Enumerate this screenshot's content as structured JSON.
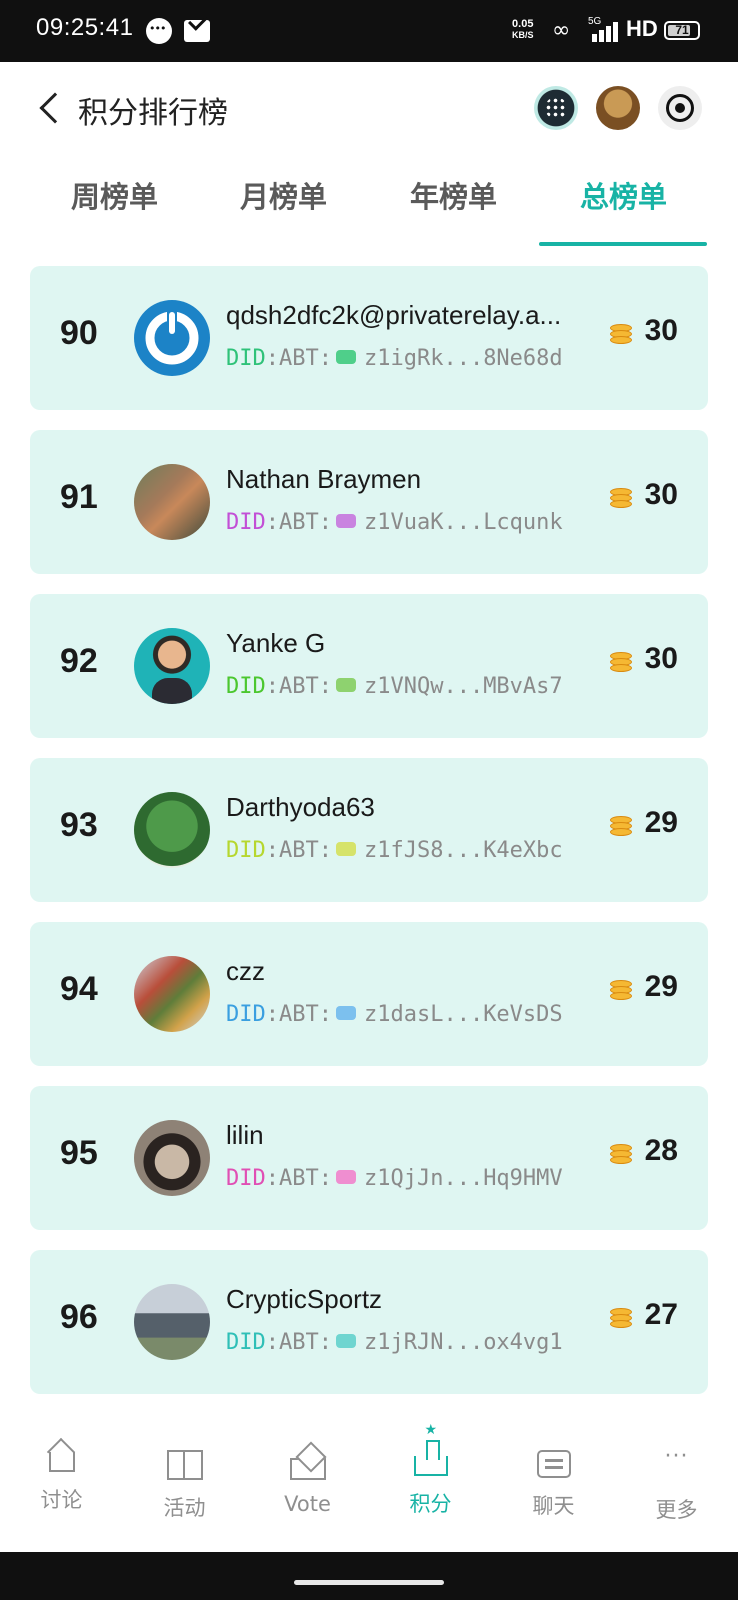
{
  "status_bar": {
    "time": "09:25:41",
    "net_speed_value": "0.05",
    "net_speed_unit": "KB/S",
    "signal_label": "5G",
    "hd_label": "HD",
    "battery": "71"
  },
  "header": {
    "title": "积分排行榜"
  },
  "tabs": [
    {
      "label": "周榜单",
      "active": false
    },
    {
      "label": "月榜单",
      "active": false
    },
    {
      "label": "年榜单",
      "active": false
    },
    {
      "label": "总榜单",
      "active": true
    }
  ],
  "did_prefix": "DID",
  "did_method": ":ABT:",
  "leaderboard": [
    {
      "rank": "90",
      "name": "qdsh2dfc2k@privaterelay.a...",
      "did": "z1igRk...8Ne68d",
      "score": "30",
      "did_color": "#2fc279",
      "avatar": "power-logo-avatar"
    },
    {
      "rank": "91",
      "name": "Nathan Braymen",
      "did": "z1VuaK...Lcqunk",
      "score": "30",
      "did_color": "#c24fd6",
      "avatar": "photo-avatar"
    },
    {
      "rank": "92",
      "name": "Yanke G",
      "did": "z1VNQw...MBvAs7",
      "score": "30",
      "did_color": "#4bc72f",
      "avatar": "cartoon-avatar"
    },
    {
      "rank": "93",
      "name": "Darthyoda63",
      "did": "z1fJS8...K4eXbc",
      "score": "29",
      "did_color": "#b6d72f",
      "avatar": "frog-avatar"
    },
    {
      "rank": "94",
      "name": "czz",
      "did": "z1dasL...KeVsDS",
      "score": "29",
      "did_color": "#3a9fe0",
      "avatar": "pixel-avatar"
    },
    {
      "rank": "95",
      "name": "lilin",
      "did": "z1QjJn...Hq9HMV",
      "score": "28",
      "did_color": "#e04fb4",
      "avatar": "portrait-avatar"
    },
    {
      "rank": "96",
      "name": "CrypticSportz",
      "did": "z1jRJN...ox4vg1",
      "score": "27",
      "did_color": "#2fbfb7",
      "avatar": "car-avatar"
    }
  ],
  "bottom_nav": [
    {
      "label": "讨论",
      "icon": "home-icon",
      "active": false
    },
    {
      "label": "活动",
      "icon": "gift-icon",
      "active": false
    },
    {
      "label": "Vote",
      "icon": "vote-icon",
      "active": false
    },
    {
      "label": "积分",
      "icon": "ranking-icon",
      "active": true
    },
    {
      "label": "聊天",
      "icon": "chat-icon",
      "active": false
    },
    {
      "label": "更多",
      "icon": "more-icon",
      "active": false
    }
  ],
  "colors": {
    "accent": "#18b3a5",
    "row_background": "#dff6f2",
    "coin": "#f5b833"
  }
}
